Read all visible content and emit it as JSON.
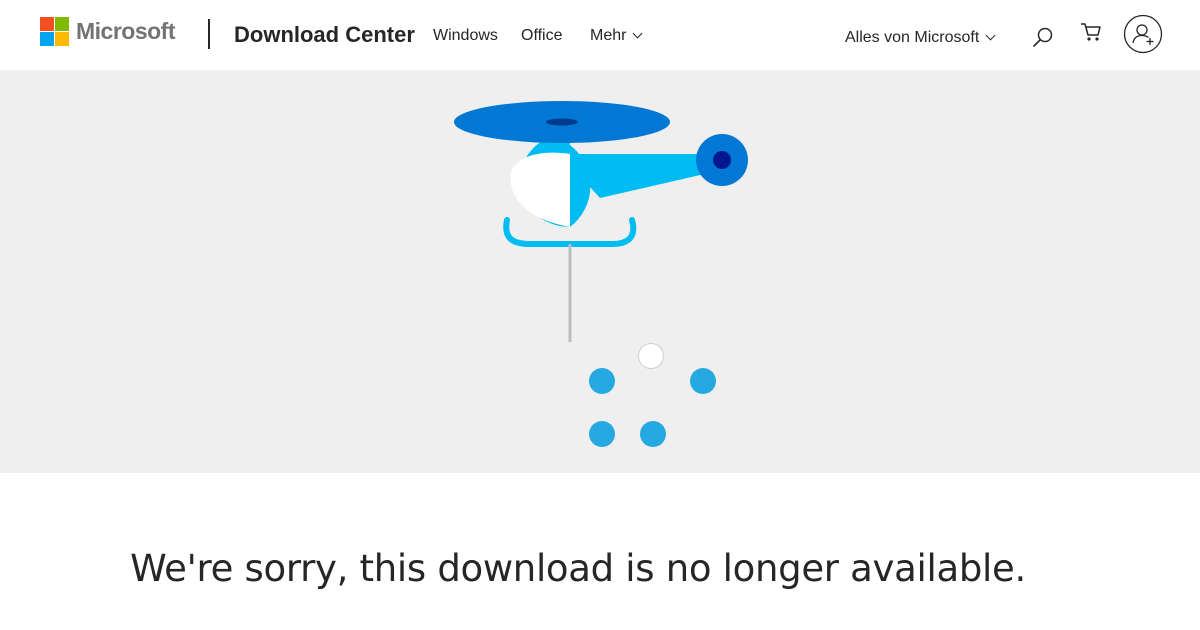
{
  "header": {
    "brand": "Microsoft",
    "site_title": "Download Center",
    "nav": [
      "Windows",
      "Office"
    ],
    "more_label": "Mehr",
    "all_microsoft_label": "Alles von Microsoft",
    "icons": {
      "search": "search-icon",
      "cart": "cart-icon",
      "account": "account-icon"
    }
  },
  "colors": {
    "logo_red": "#f25022",
    "logo_green": "#7fba00",
    "logo_blue": "#00a4ef",
    "logo_yellow": "#ffb900",
    "hero_background": "#efefef",
    "rotor": "#0078d4",
    "body": "#00bcf2",
    "dots": "#26a9e0"
  },
  "main": {
    "message": "We're sorry, this download is no longer available."
  }
}
